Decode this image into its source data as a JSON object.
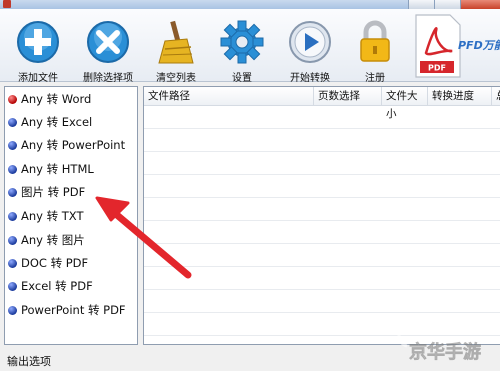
{
  "toolbar": {
    "items": [
      {
        "label": "添加文件",
        "icon": "add-icon"
      },
      {
        "label": "删除选择项",
        "icon": "delete-icon"
      },
      {
        "label": "清空列表",
        "icon": "broom-icon"
      },
      {
        "label": "设置",
        "icon": "gear-icon"
      },
      {
        "label": "开始转换",
        "icon": "play-icon"
      },
      {
        "label": "注册",
        "icon": "lock-icon"
      }
    ],
    "brand_text": "PFD万能",
    "brand_doc_label": "PDF"
  },
  "options": [
    {
      "label": "Any 转 Word",
      "selected": true
    },
    {
      "label": "Any 转 Excel",
      "selected": false
    },
    {
      "label": "Any 转 PowerPoint",
      "selected": false
    },
    {
      "label": "Any 转 HTML",
      "selected": false
    },
    {
      "label": "图片 转 PDF",
      "selected": false
    },
    {
      "label": "Any 转 TXT",
      "selected": false
    },
    {
      "label": "Any 转 图片",
      "selected": false
    },
    {
      "label": "DOC 转 PDF",
      "selected": false
    },
    {
      "label": "Excel 转 PDF",
      "selected": false
    },
    {
      "label": "PowerPoint 转 PDF",
      "selected": false
    }
  ],
  "table": {
    "columns": [
      "文件路径",
      "页数选择",
      "文件大小",
      "转换进度",
      "总"
    ]
  },
  "output_label": "输出选项",
  "watermark": "京华手游",
  "colors": {
    "accent": "#2d6fc4",
    "arrow": "#e3262c",
    "selected_dot": "#b30000"
  }
}
